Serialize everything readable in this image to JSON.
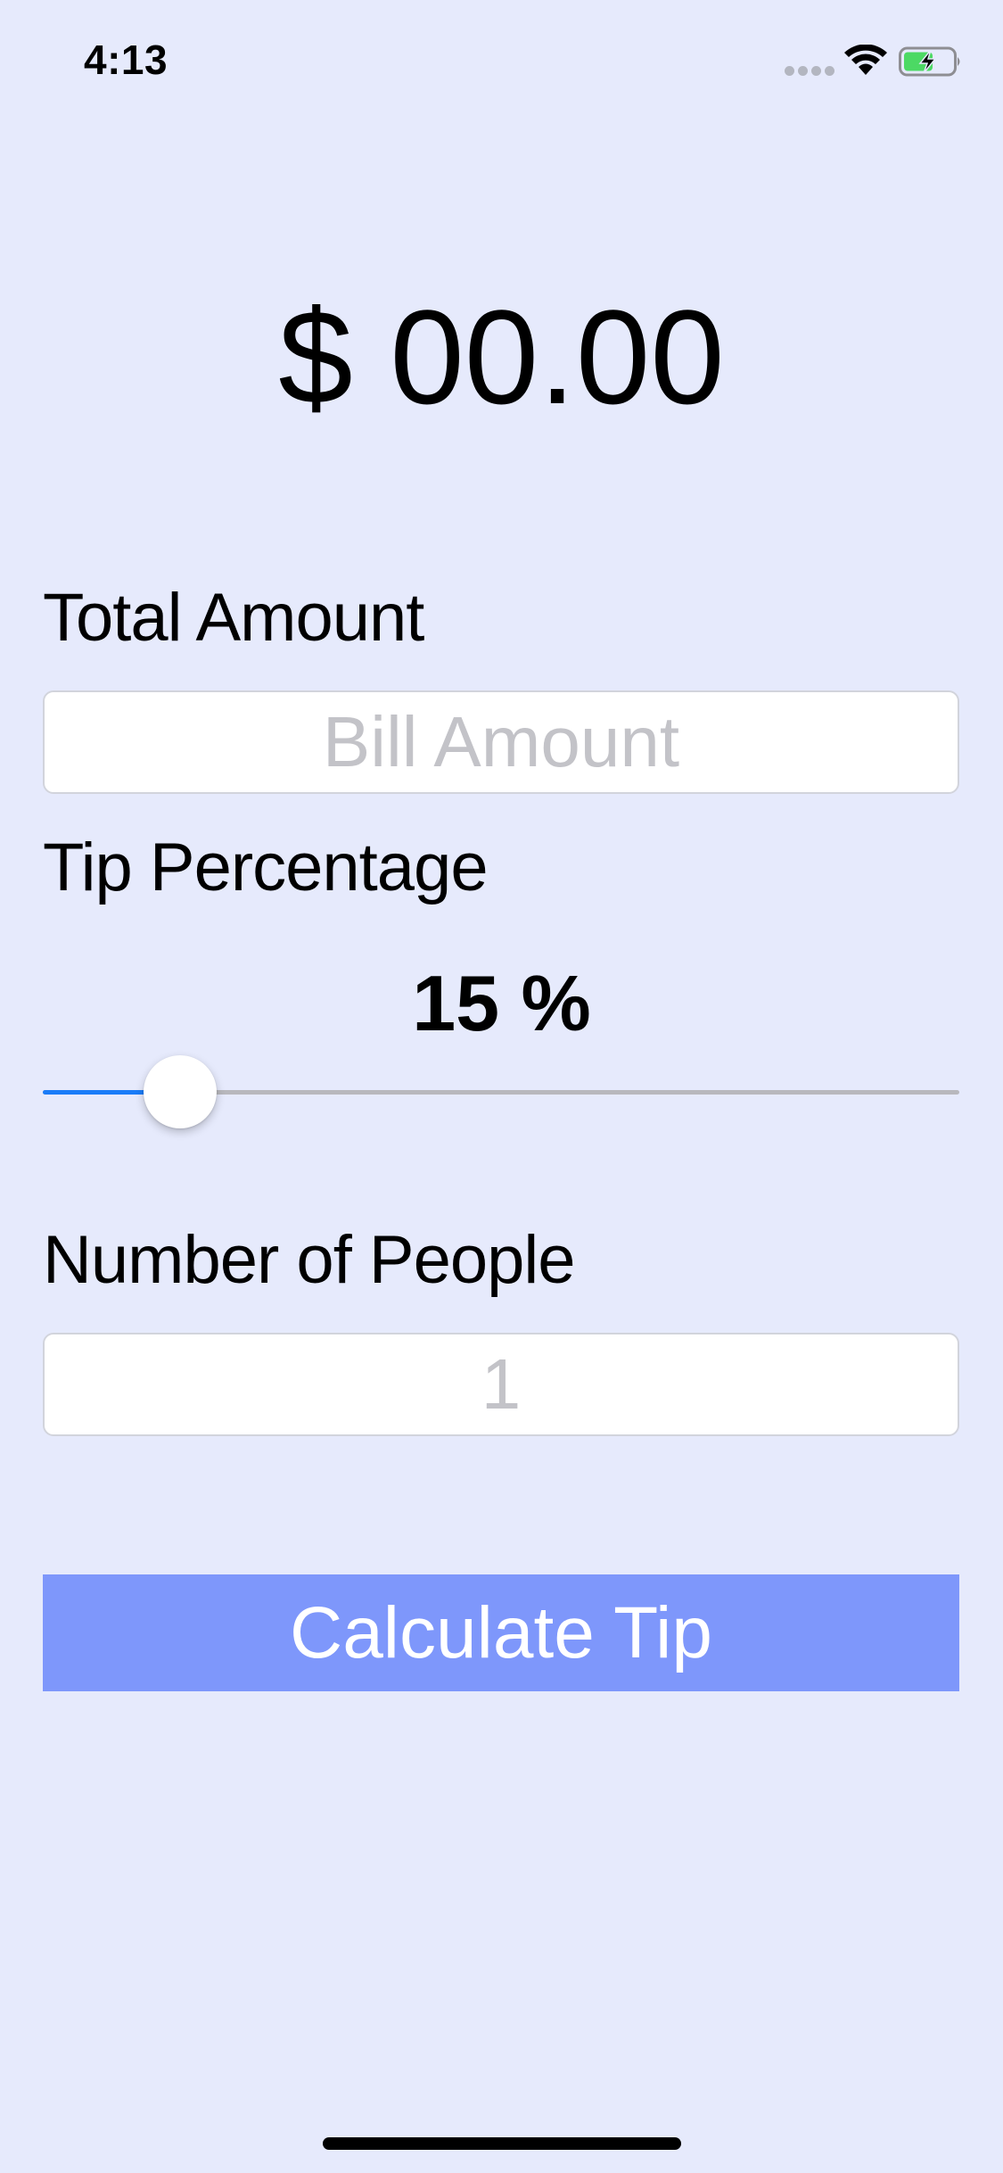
{
  "status_bar": {
    "time": "4:13",
    "icons": [
      "signal-dots-icon",
      "wifi-icon",
      "battery-charging-icon"
    ],
    "battery_color": "#4cd964"
  },
  "total_display": "$ 00.00",
  "bill": {
    "label": "Total Amount",
    "placeholder": "Bill Amount",
    "value": ""
  },
  "tip": {
    "label": "Tip Percentage",
    "value_text": "15 %",
    "percent": 15,
    "slider_fraction": 0.15
  },
  "people": {
    "label": "Number of People",
    "placeholder": "1",
    "value": ""
  },
  "calculate_button": {
    "label": "Calculate Tip"
  },
  "colors": {
    "background": "#e6eafc",
    "button": "#7e97fb",
    "slider_fill": "#1a7cf8"
  }
}
